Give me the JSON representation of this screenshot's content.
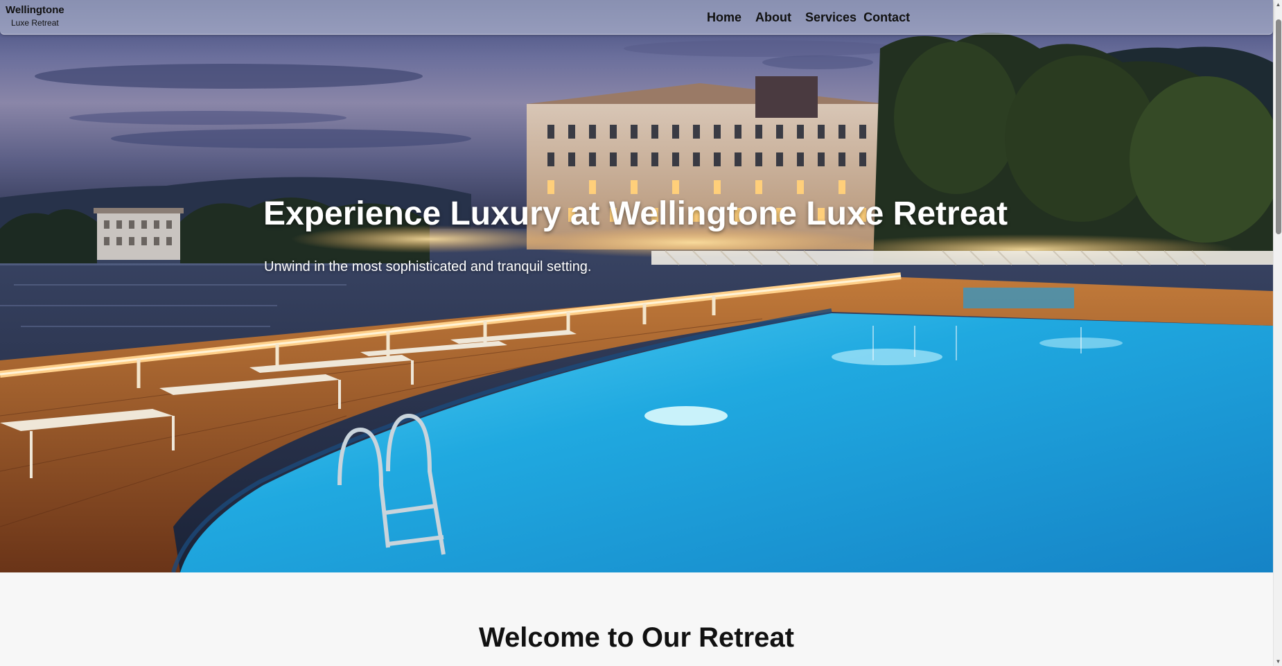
{
  "brand": {
    "name": "Wellingtone",
    "tagline": "Luxe Retreat"
  },
  "nav": {
    "items": [
      {
        "label": "Home"
      },
      {
        "label": "About"
      },
      {
        "label": "Services"
      },
      {
        "label": "Contact"
      }
    ]
  },
  "hero": {
    "title": "Experience Luxury at Wellingtone Luxe Retreat",
    "subtitle": "Unwind in the most sophisticated and tranquil setting.",
    "image_description": "photo-hero-hotel-pool-lakeside-dusk"
  },
  "welcome": {
    "title": "Welcome to Our Retreat"
  },
  "scrollbar": {
    "up_icon": "arrow-up-icon",
    "down_icon": "arrow-down-icon"
  },
  "colors": {
    "nav_background": "#c8cde1",
    "text_dark": "#111111",
    "text_light": "#ffffff",
    "pool_blue": "#2bb6e6",
    "deck_wood": "#a65a2a",
    "page_background": "#f7f7f7"
  }
}
